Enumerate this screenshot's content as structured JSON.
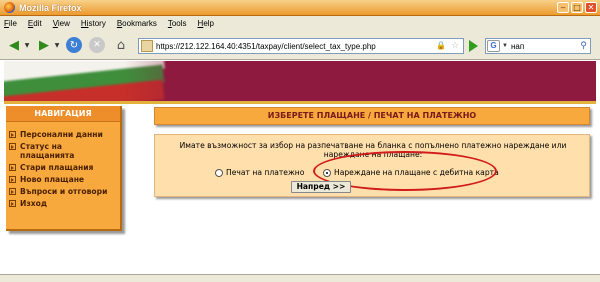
{
  "window": {
    "title": "Mozilla Firefox"
  },
  "menu": {
    "items": [
      {
        "label": "File",
        "u": "F",
        "rest": "ile"
      },
      {
        "label": "Edit",
        "u": "E",
        "rest": "dit"
      },
      {
        "label": "View",
        "u": "V",
        "rest": "iew"
      },
      {
        "label": "History",
        "u": "Hi",
        "rest": "story"
      },
      {
        "label": "Bookmarks",
        "u": "B",
        "rest": "ookmarks"
      },
      {
        "label": "Tools",
        "u": "T",
        "rest": "ools"
      },
      {
        "label": "Help",
        "u": "H",
        "rest": "elp"
      }
    ]
  },
  "toolbar": {
    "url": "https://212.122.164.40:4351/taxpay/client/select_tax_type.php",
    "search_value": "нап"
  },
  "sidebar": {
    "heading": "НАВИГАЦИЯ",
    "items": [
      {
        "label": "Персонални данни"
      },
      {
        "label": "Статус на плащанията"
      },
      {
        "label": "Стари плащания"
      },
      {
        "label": "Ново плащане"
      },
      {
        "label": "Въпроси и отговори"
      },
      {
        "label": "Изход"
      }
    ]
  },
  "main": {
    "heading": "ИЗБЕРЕТЕ ПЛАЩАНЕ / ПЕЧАТ НА ПЛАТЕЖНО",
    "info": "Имате възможност за избор на разпечатване на бланка с попълнено платежно нареждане или нареждане на плащане:",
    "option1": "Печат на платежно",
    "option2": "Нареждане на плащане с дебитна карта",
    "next_button": "Напред >>"
  },
  "colors": {
    "accent_orange": "#f7a93e",
    "panel_bg": "#ffe0ad",
    "highlight_red": "#d01c1c",
    "banner_maroon": "#8e1a3f"
  }
}
